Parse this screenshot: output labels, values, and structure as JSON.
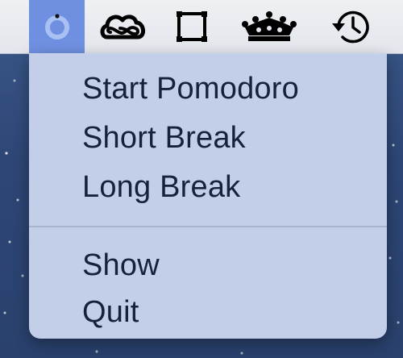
{
  "menubar": {
    "items": [
      {
        "id": "pomodoro",
        "icon": "pomodoro-ring-icon",
        "active": true
      },
      {
        "id": "creative-cloud",
        "icon": "creative-cloud-icon",
        "active": false
      },
      {
        "id": "window",
        "icon": "square-icon",
        "active": false
      },
      {
        "id": "crown",
        "icon": "crown-icon",
        "active": false
      },
      {
        "id": "time-machine",
        "icon": "history-clock-icon",
        "active": false
      }
    ],
    "active_color": "#6f8fe0"
  },
  "menu": {
    "items": [
      {
        "label": "Start Pomodoro"
      },
      {
        "label": "Short Break"
      },
      {
        "label": "Long Break"
      }
    ],
    "items_after_separator": [
      {
        "label": "Show"
      },
      {
        "label": "Quit"
      }
    ]
  }
}
